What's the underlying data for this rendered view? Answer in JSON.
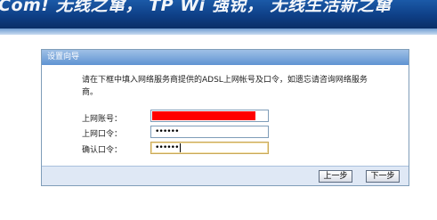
{
  "banner": {
    "text": "Com! 无线之窜， TP Wi 强锐， 无线生活新之窜"
  },
  "wizard": {
    "title": "设置向导",
    "description": "请在下框中填入网络服务商提供的ADSL上网帐号及口令，如遗忘请咨询网络服务商。",
    "fields": {
      "account_label": "上网账号：",
      "account_value": "",
      "password_label": "上网口令：",
      "password_value": "••••••",
      "confirm_label": "确认口令：",
      "confirm_value": "••••••"
    },
    "buttons": {
      "prev": "上一步",
      "next": "下一步"
    }
  },
  "colors": {
    "banner": "#0e3f86",
    "panel_header": "#6f9ed6",
    "redaction": "#ff0000"
  }
}
